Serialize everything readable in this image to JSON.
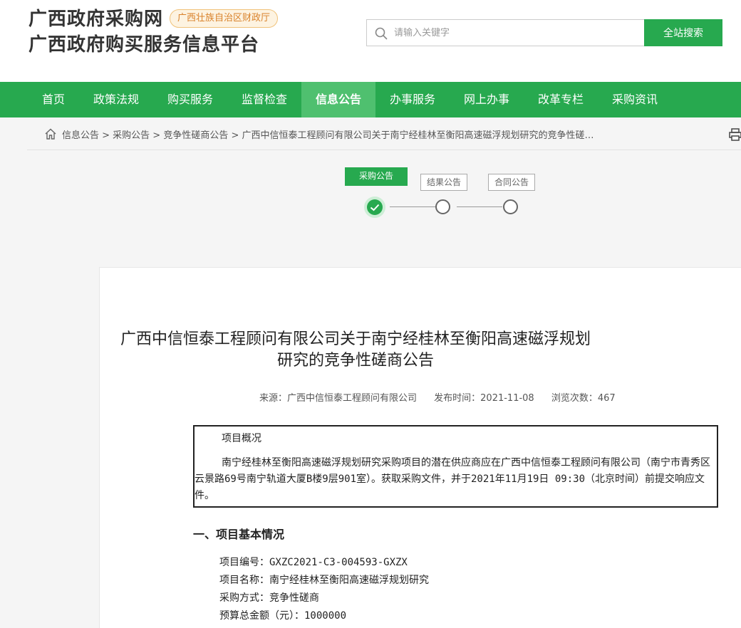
{
  "header": {
    "site_name": "广西政府采购网",
    "badge": "广西壮族自治区财政厅",
    "subtitle": "广西政府购买服务信息平台",
    "search_placeholder": "请输入关键字",
    "search_button": "全站搜索"
  },
  "nav": {
    "items": [
      "首页",
      "政策法规",
      "购买服务",
      "监督检查",
      "信息公告",
      "办事服务",
      "网上办事",
      "改革专栏",
      "采购资讯"
    ],
    "active_index": 4
  },
  "breadcrumb": {
    "text": "信息公告 > 采购公告 > 竞争性磋商公告 > 广西中信恒泰工程顾问有限公司关于南宁经桂林至衡阳高速磁浮规划研究的竞争性磋…"
  },
  "steps": [
    {
      "label": "采购公告",
      "done": true
    },
    {
      "label": "结果公告",
      "done": false
    },
    {
      "label": "合同公告",
      "done": false
    }
  ],
  "article": {
    "title_line1": "广西中信恒泰工程顾问有限公司关于南宁经桂林至衡阳高速磁浮规划",
    "title_line2": "研究的竞争性磋商公告",
    "source": "来源：广西中信恒泰工程顾问有限公司",
    "publish_time": "发布时间：2021-11-08",
    "views": "浏览次数：467",
    "overview_head": "项目概况",
    "overview_body": "南宁经桂林至衡阳高速磁浮规划研究采购项目的潜在供应商应在广西中信恒泰工程顾问有限公司（南宁市青秀区云景路69号南宁轨道大厦B楼9层901室）。获取采购文件，并于2021年11月19日 09:30（北京时间）前提交响应文件。",
    "section1_head": "一、项目基本情况",
    "project_no": "项目编号：GXZC2021-C3-004593-GXZX",
    "project_name": "项目名称：南宁经桂林至衡阳高速磁浮规划研究",
    "method": "采购方式：竞争性磋商",
    "budget": "预算总金额（元）：1000000"
  },
  "colors": {
    "brand_green": "#27a94f",
    "active_nav": "#4fc06f",
    "badge_orange": "#d9822b"
  }
}
